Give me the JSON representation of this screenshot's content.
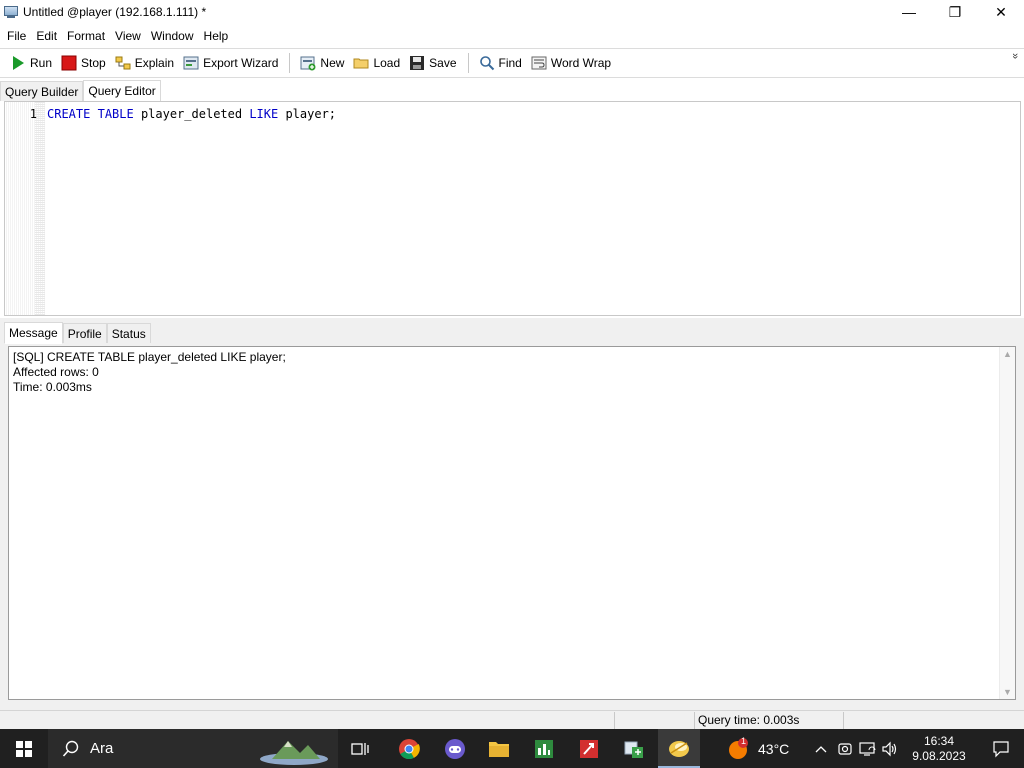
{
  "window": {
    "title": "Untitled @player (192.168.1.111) *",
    "controls": [
      "—",
      "❐",
      "✕"
    ]
  },
  "menu": [
    {
      "label": "File"
    },
    {
      "label": "Edit"
    },
    {
      "label": "Format"
    },
    {
      "label": "View"
    },
    {
      "label": "Window"
    },
    {
      "label": "Help"
    }
  ],
  "toolbar": {
    "run": "Run",
    "stop": "Stop",
    "explain": "Explain",
    "export_wizard": "Export Wizard",
    "new": "New",
    "load": "Load",
    "save": "Save",
    "find": "Find",
    "word_wrap": "Word Wrap",
    "overflow": "»"
  },
  "top_tabs": [
    {
      "label": "Query Builder",
      "active": false
    },
    {
      "label": "Query Editor",
      "active": true
    }
  ],
  "editor": {
    "line_number": "1",
    "tokens": [
      {
        "text": "CREATE",
        "kind": "kw"
      },
      {
        "text": " ",
        "kind": "id"
      },
      {
        "text": "TABLE",
        "kind": "kw"
      },
      {
        "text": " player_deleted ",
        "kind": "id"
      },
      {
        "text": "LIKE",
        "kind": "kw"
      },
      {
        "text": " player;",
        "kind": "id"
      }
    ]
  },
  "bottom_tabs": [
    {
      "label": "Message",
      "active": true
    },
    {
      "label": "Profile",
      "active": false
    },
    {
      "label": "Status",
      "active": false
    }
  ],
  "message": {
    "lines": [
      "[SQL] CREATE TABLE player_deleted LIKE player;",
      "Affected rows: 0",
      "Time: 0.003ms"
    ]
  },
  "status": {
    "query_time": "Query time: 0.003s"
  },
  "taskbar": {
    "search_placeholder": "Ara",
    "weather": "43°C",
    "time": "16:34",
    "date": "9.08.2023",
    "weather_badge": "1"
  },
  "colors": {
    "keyword": "#0000c8",
    "taskbar": "#202020",
    "run_green": "#1a9a2a",
    "stop_red": "#d81818"
  }
}
